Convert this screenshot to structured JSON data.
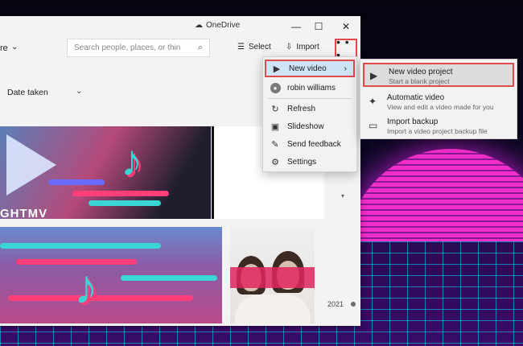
{
  "window": {
    "title_service": "OneDrive",
    "controls": {
      "minimize": "—",
      "maximize": "☐",
      "close": "✕"
    }
  },
  "toolbar": {
    "nav_partial_label": "re",
    "search_placeholder": "Search people, places, or thin",
    "select_label": "Select",
    "import_label": "Import",
    "more_label": "• • •"
  },
  "view": {
    "sort_label": "Date taken"
  },
  "gallery": {
    "thumb1_brand_text": "GHTMV",
    "year_label": "2021"
  },
  "menu": {
    "items": [
      {
        "label": "New video",
        "icon": "video-icon",
        "has_submenu": true
      },
      {
        "label": "robin williams",
        "icon": "person-icon"
      },
      {
        "label": "Refresh",
        "icon": "refresh-icon"
      },
      {
        "label": "Slideshow",
        "icon": "slideshow-icon"
      },
      {
        "label": "Send feedback",
        "icon": "feedback-icon"
      },
      {
        "label": "Settings",
        "icon": "gear-icon"
      }
    ]
  },
  "submenu": {
    "items": [
      {
        "title": "New video project",
        "description": "Start a blank project",
        "icon": "video-project-icon"
      },
      {
        "title": "Automatic video",
        "description": "View and edit a video made for you",
        "icon": "magic-wand-icon"
      },
      {
        "title": "Import backup",
        "description": "Import a video project backup file",
        "icon": "archive-icon"
      }
    ]
  },
  "colors": {
    "highlight_border": "#e04a4a",
    "menu_hover": "#cfe3f7",
    "sun": "#ff2fd1",
    "grid": "#00e1ff"
  }
}
